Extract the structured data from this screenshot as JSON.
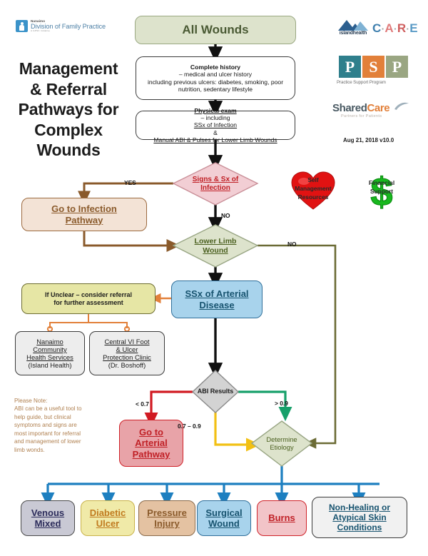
{
  "document": {
    "title_lines": [
      "Management",
      "& Referral",
      "Pathways for",
      "Complex",
      "Wounds"
    ],
    "version_date": "Aug 21, 2018 v10.0"
  },
  "logos": {
    "nanaimo": {
      "small": "Nanaimo",
      "big": "Division of Family Practice",
      "tiny": "A GPSC Initiative"
    },
    "island_health": {
      "word": "islandhealth",
      "icon": "mountain-icon"
    },
    "care": {
      "letters": [
        "C",
        "A",
        "R",
        "E"
      ],
      "separator": "·"
    },
    "psp": {
      "letters": [
        "P",
        "S",
        "P"
      ],
      "caption": "Practice Support Program"
    },
    "shared_care": {
      "part1": "Shared",
      "part2": "Care",
      "caption": "Partners for Patients",
      "icon": "swoosh-icon"
    }
  },
  "icons": {
    "self_management": {
      "name": "heart-icon",
      "label_lines": [
        "Self",
        "Management",
        "Resources"
      ],
      "color": "#e11212"
    },
    "financial_support": {
      "name": "dollar-sign-icon",
      "label_lines": [
        "Financial",
        "Support"
      ],
      "color": "#18b81e"
    }
  },
  "nodes": {
    "all_wounds": {
      "label": "All Wounds",
      "shape": "rounded-rect",
      "fill": "#dde3cc"
    },
    "complete_history": {
      "shape": "rounded-rect",
      "fill": "#ffffff",
      "lines": [
        {
          "bold": "Complete history",
          "rest": " – medical and ulcer history"
        },
        {
          "bold": "",
          "rest": "including previous ulcers: diabetes, smoking, poor"
        },
        {
          "bold": "",
          "rest": "nutrition, sedentary lifestyle"
        }
      ]
    },
    "physical_exam": {
      "shape": "rounded-rect",
      "fill": "#ffffff",
      "lines": [
        {
          "bold_u": "Physical exam",
          "rest": " – including ",
          "u": "SSx of Infection",
          "tail": " &"
        },
        {
          "u2": "Manual ABI & Pulses for Lower Limb Wounds"
        }
      ]
    },
    "signs_sx_infection": {
      "label_lines": [
        "Signs & Sx of",
        "Infection"
      ],
      "shape": "diamond",
      "fill": "#f2ced4",
      "stroke": "#c98f98",
      "text_color": "#c02026"
    },
    "go_to_infection_pathway": {
      "label_lines": [
        "Go to Infection",
        "Pathway"
      ],
      "shape": "rounded-rect",
      "fill": "#f3e3d6",
      "stroke": "#9c6a3f",
      "text_color": "#8a5a2b"
    },
    "lower_limb_wound": {
      "label_lines": [
        "Lower Limb",
        "Wound"
      ],
      "shape": "diamond",
      "fill": "#dde3cc",
      "stroke": "#98a583",
      "text_color": "#4b6020"
    },
    "ssx_arterial_disease": {
      "label_lines": [
        "SSx of Arterial",
        "Disease"
      ],
      "shape": "rounded-rect",
      "fill": "#a8d3ec",
      "stroke": "#2f6f9a",
      "text_color": "#17536f"
    },
    "if_unclear": {
      "label_lines": [
        "If Unclear – consider referral",
        "for further assessment"
      ],
      "shape": "rounded-rect",
      "fill": "#e6e6a5",
      "stroke": "#6d6d30",
      "text_color": "#1c1c1c"
    },
    "nanaimo_community": {
      "label_lines": [
        "Nanaimo",
        "Community",
        "Health Services",
        "(Island Health)"
      ],
      "underlined": 3,
      "shape": "rounded-rect",
      "fill": "#ededed",
      "stroke": "#3a3a3a"
    },
    "central_vi_clinic": {
      "label_lines": [
        "Central VI Foot",
        "& Ulcer",
        "Protection Clinic",
        "(Dr. Boshoff)"
      ],
      "underlined": 3,
      "shape": "rounded-rect",
      "fill": "#ededed",
      "stroke": "#3a3a3a"
    },
    "abi_results": {
      "label": "ABI Results",
      "shape": "diamond",
      "fill": "#d3d3d3",
      "stroke": "#8a8a8a",
      "text_color": "#1c1c1c"
    },
    "go_to_arterial_pathway": {
      "label_lines": [
        "Go to",
        "Arterial",
        "Pathway"
      ],
      "shape": "rounded-rect",
      "fill": "#e8a3a8",
      "stroke": "#cf2229",
      "text_color": "#c02026"
    },
    "determine_etiology": {
      "label_lines": [
        "Determine",
        "Etiology"
      ],
      "shape": "diamond",
      "fill": "#dde3cc",
      "stroke": "#98a583",
      "text_color": "#4b6020"
    }
  },
  "edge_labels": {
    "yes": "YES",
    "no_infection": "NO",
    "no_lower_limb": "NO",
    "abi_low": "< 0.7",
    "abi_mid": "0.7 – 0.9",
    "abi_high": "> 0.9"
  },
  "note": {
    "lines": [
      "Please Note:",
      "ABI can be a useful tool to",
      "help guide, but clinical",
      "symptoms and signs are",
      "most important for referral",
      "and management of lower",
      "limb wonds."
    ]
  },
  "outcomes": [
    {
      "label_lines": [
        "Venous",
        "Mixed"
      ],
      "fill": "#c9c9d4",
      "stroke": "#4a4a4a",
      "text_color": "#2b2b5a"
    },
    {
      "label_lines": [
        "Diabetic",
        "Ulcer"
      ],
      "fill": "#f0eaa8",
      "stroke": "#c8b24a",
      "text_color": "#c07a1e"
    },
    {
      "label_lines": [
        "Pressure",
        "Injury"
      ],
      "fill": "#e4c2a2",
      "stroke": "#8a6a4a",
      "text_color": "#8a5a2b"
    },
    {
      "label_lines": [
        "Surgical",
        "Wound"
      ],
      "fill": "#a8d3ec",
      "stroke": "#2f6f9a",
      "text_color": "#17536f"
    },
    {
      "label_lines": [
        "Burns"
      ],
      "fill": "#f2c4c8",
      "stroke": "#cf2229",
      "text_color": "#c02026"
    },
    {
      "label_lines": [
        "Non-Healing or",
        "Atypical Skin",
        "Conditions"
      ],
      "fill": "#f1f1f1",
      "stroke": "#3a3a3a",
      "text_color": "#17536f"
    }
  ],
  "colors": {
    "arrow_black": "#111111",
    "arrow_brown": "#8a5a2b",
    "arrow_olive": "#6b6b35",
    "arrow_orange": "#e2803a",
    "arrow_red": "#d11a22",
    "arrow_green": "#17a06a",
    "arrow_yellow": "#f2c014",
    "arrow_blue": "#1d7fc0"
  }
}
